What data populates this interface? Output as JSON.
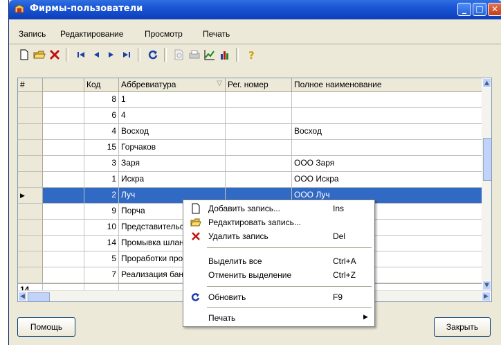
{
  "window": {
    "title": "Фирмы-пользователи"
  },
  "menu": {
    "items": [
      "Запись",
      "Редактирование",
      "Просмотр",
      "Печать"
    ]
  },
  "toolbar": {
    "icons": [
      "new-doc-icon",
      "open-folder-icon",
      "delete-icon",
      "first-record-icon",
      "prev-record-icon",
      "next-record-icon",
      "last-record-icon",
      "refresh-icon",
      "print-preview-icon",
      "print-icon",
      "chart-icon",
      "bar-chart-icon",
      "help-icon"
    ]
  },
  "grid": {
    "columns": [
      "#",
      "",
      "Код",
      "Аббревиатура",
      "Рег. номер",
      "Полное наименование"
    ],
    "rows": [
      {
        "code": "8",
        "abbr": "1",
        "reg": "",
        "full": ""
      },
      {
        "code": "6",
        "abbr": "4",
        "reg": "",
        "full": ""
      },
      {
        "code": "4",
        "abbr": "Восход",
        "reg": "",
        "full": "Восход"
      },
      {
        "code": "15",
        "abbr": "Горчаков",
        "reg": "",
        "full": ""
      },
      {
        "code": "3",
        "abbr": "Заря",
        "reg": "",
        "full": "ООО Заря"
      },
      {
        "code": "1",
        "abbr": "Искра",
        "reg": "",
        "full": "ООО Искра"
      },
      {
        "code": "2",
        "abbr": "Луч",
        "reg": "",
        "full": "ООО Луч"
      },
      {
        "code": "9",
        "abbr": "Порча",
        "reg": "",
        "full": ""
      },
      {
        "code": "10",
        "abbr": "Представительс",
        "reg": "",
        "full": ""
      },
      {
        "code": "14",
        "abbr": "Промывка шлан",
        "reg": "",
        "full": ""
      },
      {
        "code": "5",
        "abbr": "Проработки про",
        "reg": "",
        "full": ""
      },
      {
        "code": "7",
        "abbr": "Реализация бан",
        "reg": "",
        "full": ""
      }
    ],
    "selected_index": 6,
    "footer_count": "14"
  },
  "context_menu": {
    "items": [
      {
        "label": "Добавить запись...",
        "shortcut": "Ins",
        "icon": "new-doc-icon"
      },
      {
        "label": "Редактировать запись...",
        "shortcut": "",
        "icon": "edit-folder-icon"
      },
      {
        "label": "Удалить запись",
        "shortcut": "Del",
        "icon": "delete-icon"
      },
      {
        "label": "Выделить все",
        "shortcut": "Ctrl+A",
        "icon": ""
      },
      {
        "label": "Отменить выделение",
        "shortcut": "Ctrl+Z",
        "icon": ""
      },
      {
        "label": "Обновить",
        "shortcut": "F9",
        "icon": "refresh-icon"
      },
      {
        "label": "Печать",
        "shortcut": "",
        "icon": "submenu-arrow-icon"
      }
    ]
  },
  "buttons": {
    "help": "Помощь",
    "close": "Закрыть"
  }
}
